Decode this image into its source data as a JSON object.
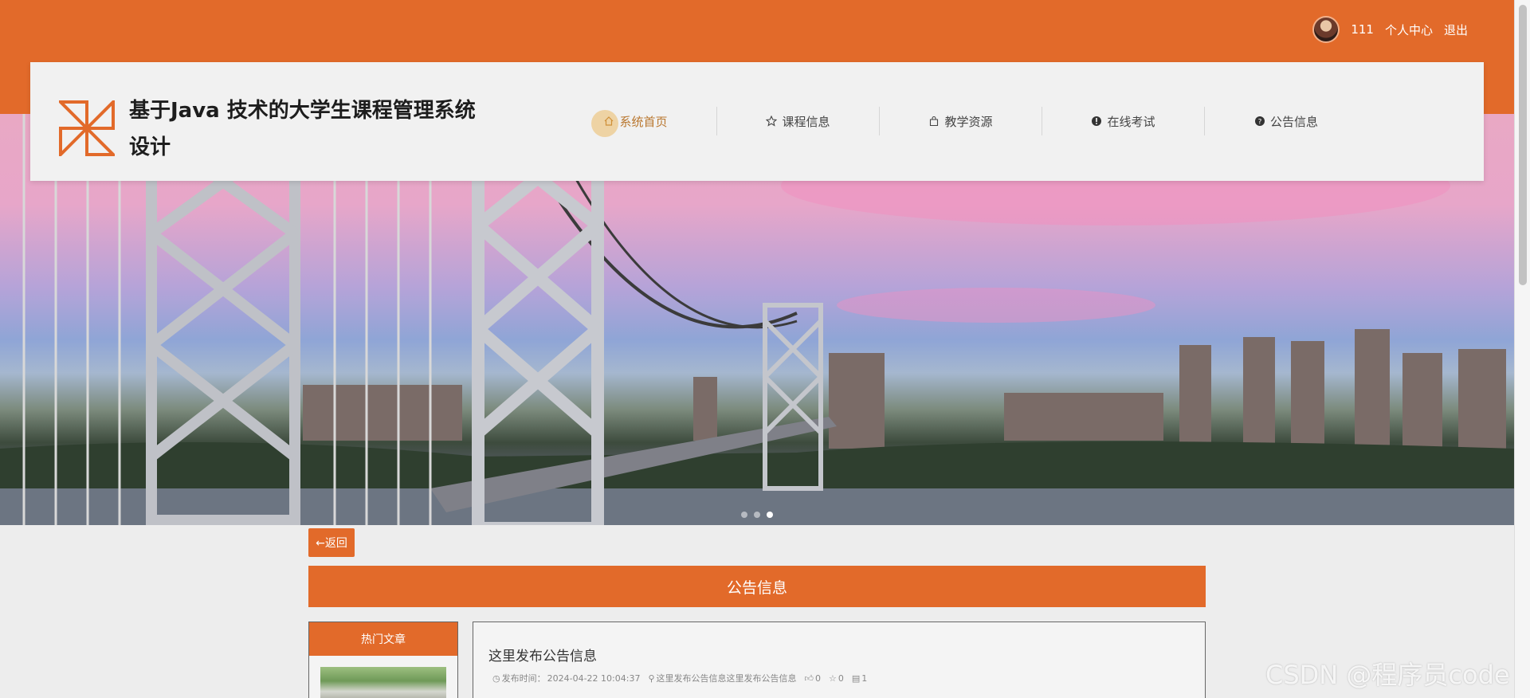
{
  "user": {
    "name": "111",
    "center_label": "个人中心",
    "logout_label": "退出"
  },
  "site": {
    "title": "基于Java 技术的大学生课程管理系统设计"
  },
  "nav": [
    {
      "label": "系统首页",
      "icon": "home-icon"
    },
    {
      "label": "课程信息",
      "icon": "star-icon"
    },
    {
      "label": "教学资源",
      "icon": "bag-icon"
    },
    {
      "label": "在线考试",
      "icon": "alert-icon"
    },
    {
      "label": "公告信息",
      "icon": "help-icon"
    }
  ],
  "banner": {
    "dots": 3,
    "active_dot": 3
  },
  "back_label": "←返回",
  "section_title": "公告信息",
  "sidebar": {
    "title": "热门文章"
  },
  "post": {
    "title": "这里发布公告信息",
    "time_label": "发布时间：",
    "time": "2024-04-22 10:04:37",
    "author": "这里发布公告信息这里发布公告信息",
    "likes": "0",
    "favorites": "0",
    "comments": "1"
  },
  "watermark": "CSDN @程序员code",
  "colors": {
    "brand": "#e26a2a",
    "nav_active": "#b9772f"
  }
}
